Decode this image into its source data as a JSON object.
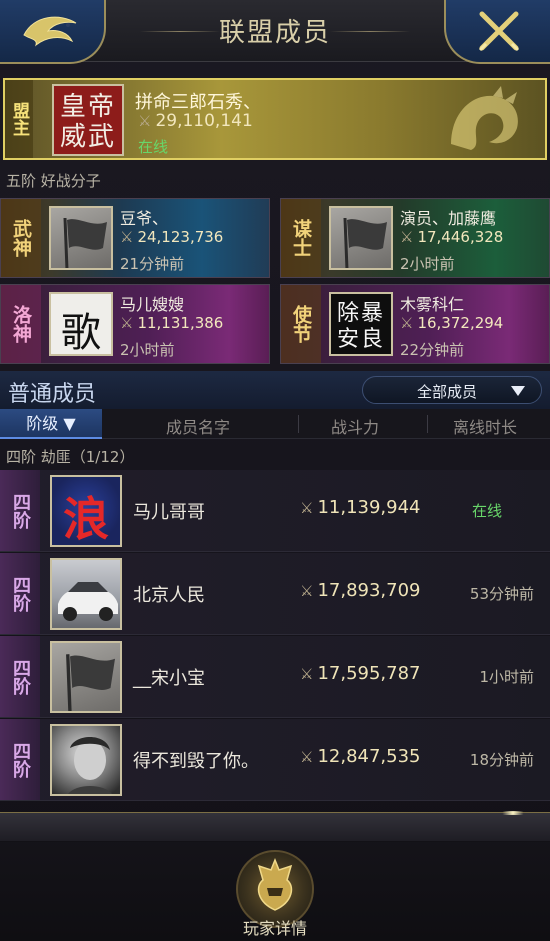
{
  "header": {
    "title": "联盟成员"
  },
  "leader": {
    "rank": "盟主",
    "avatar_text": "皇帝威武",
    "name": "拼命三郎石秀、",
    "power": "29,110,141",
    "status": "在线"
  },
  "rank5": {
    "label": "五阶  好战分子",
    "officers": [
      {
        "title": "武神",
        "name": "豆爷、",
        "power": "24,123,736",
        "time": "21分钟前"
      },
      {
        "title": "谋士",
        "name": "演员、加藤鹰",
        "power": "17,446,328",
        "time": "2小时前"
      },
      {
        "title": "洛神",
        "name": "马儿嫂嫂",
        "power": "11,131,386",
        "time": "2小时前",
        "avatar_text": "歌"
      },
      {
        "title": "使节",
        "name": "木雾科仁",
        "power": "16,372,294",
        "time": "22分钟前",
        "avatar_text": "除暴安良"
      }
    ]
  },
  "normal": {
    "title": "普通成员",
    "filter_label": "全部成员",
    "columns": {
      "rank": "阶级",
      "name": "成员名字",
      "power": "战斗力",
      "offline": "离线时长"
    },
    "group_label": "四阶  劫匪（1/12）",
    "rows": [
      {
        "rank": "四阶",
        "avatar_text": "浪",
        "name": "马儿哥哥",
        "power": "11,139,944",
        "time": "在线"
      },
      {
        "rank": "四阶",
        "name": "北京人民",
        "power": "17,893,709",
        "time": "53分钟前"
      },
      {
        "rank": "四阶",
        "name": "__宋小宝",
        "power": "17,595,787",
        "time": "1小时前"
      },
      {
        "rank": "四阶",
        "name": "得不到毁了你。",
        "power": "12,847,535",
        "time": "18分钟前"
      }
    ]
  },
  "footer": {
    "label": "玩家详情"
  },
  "colors": {
    "online": "#68d66a",
    "gold": "#e0cf63",
    "accent_blue": "#2c4b82"
  }
}
